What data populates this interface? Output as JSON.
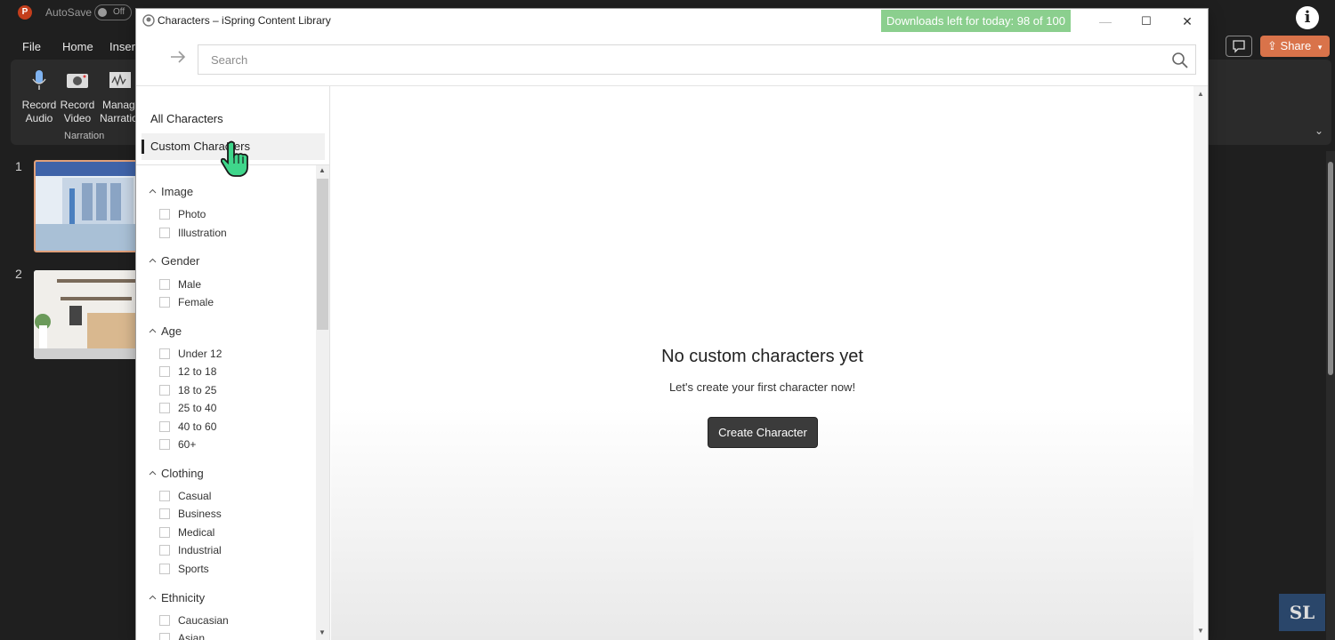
{
  "ppt": {
    "autosave_label": "AutoSave",
    "autosave_state": "Off",
    "menu": [
      "File",
      "Home",
      "Insert"
    ],
    "ribbon_buttons": [
      {
        "line1": "Record",
        "line2": "Audio"
      },
      {
        "line1": "Record",
        "line2": "Video"
      },
      {
        "line1": "Manage",
        "line2": "Narration"
      }
    ],
    "group_label": "Narration",
    "slide_numbers": [
      "1",
      "2"
    ],
    "share_label": "Share",
    "info_glyph": "i",
    "watermark_text": "SL"
  },
  "dialog": {
    "title": "Characters – iSpring Content Library",
    "downloads_badge": "Downloads left for today: 98 of 100",
    "window_buttons": {
      "minimize": "—",
      "maximize": "☐",
      "close": "✕"
    },
    "search_placeholder": "Search",
    "nav": [
      {
        "label": "All Characters",
        "active": false
      },
      {
        "label": "Custom Characters",
        "active": true
      }
    ],
    "filter_groups": [
      {
        "title": "Image",
        "options": [
          "Photo",
          "Illustration"
        ]
      },
      {
        "title": "Gender",
        "options": [
          "Male",
          "Female"
        ]
      },
      {
        "title": "Age",
        "options": [
          "Under 12",
          "12 to 18",
          "18 to 25",
          "25 to 40",
          "40 to 60",
          "60+"
        ]
      },
      {
        "title": "Clothing",
        "options": [
          "Casual",
          "Business",
          "Medical",
          "Industrial",
          "Sports"
        ]
      },
      {
        "title": "Ethnicity",
        "options": [
          "Caucasian",
          "Asian"
        ]
      }
    ],
    "empty_state": {
      "title": "No custom characters yet",
      "subtitle": "Let's create your first character now!",
      "button_label": "Create Character"
    }
  },
  "colors": {
    "downloads_badge_bg": "#8bcf8e",
    "create_button_bg": "#3b3b3b",
    "share_button_bg": "#d9734a",
    "cursor_green": "#3fd68b"
  }
}
